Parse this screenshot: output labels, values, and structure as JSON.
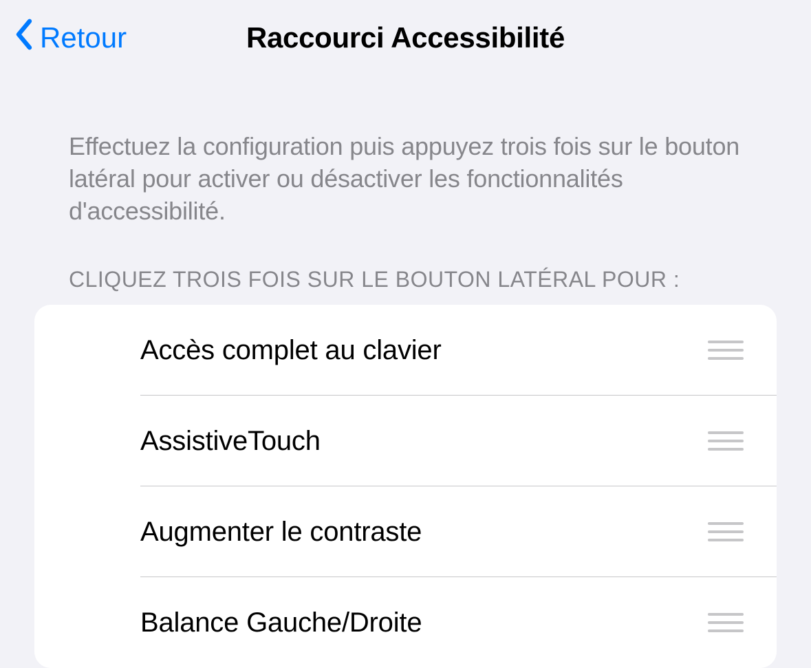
{
  "navbar": {
    "back_label": "Retour",
    "title": "Raccourci Accessibilité"
  },
  "description": "Effectuez la configuration puis appuyez trois fois sur le bouton latéral pour activer ou désactiver les fonctionnalités d'accessibilité.",
  "section_header": "CLIQUEZ TROIS FOIS SUR LE BOUTON LATÉRAL POUR :",
  "items": [
    {
      "label": "Accès complet au clavier"
    },
    {
      "label": "AssistiveTouch"
    },
    {
      "label": "Augmenter le contraste"
    },
    {
      "label": "Balance Gauche/Droite"
    }
  ]
}
